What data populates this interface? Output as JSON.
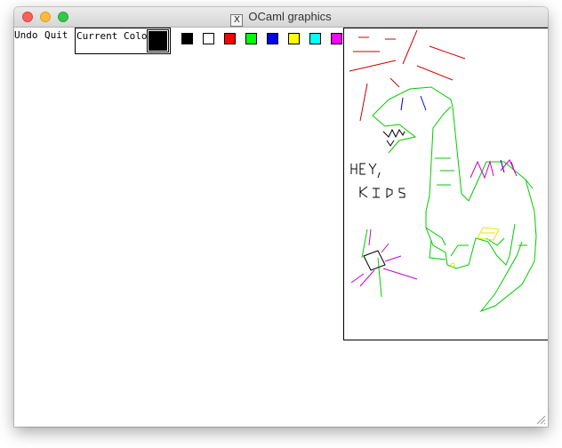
{
  "window": {
    "title": "OCaml graphics",
    "title_icon": "x11-icon"
  },
  "toolbar": {
    "undo_label": "Undo",
    "quit_label": "Quit",
    "current_color_label": "Current Color",
    "current_color": "#000000",
    "palette": [
      "#000000",
      "#ffffff",
      "#ff0000",
      "#00ff00",
      "#0000ff",
      "#ffff00",
      "#00ffff",
      "#ff00ff"
    ]
  },
  "drawing": {
    "text_hey": "HEY,",
    "text_kids": "KIDS",
    "colors": {
      "red": "#cc0000",
      "green": "#00cc00",
      "magenta": "#cc00cc",
      "blue": "#0000cc",
      "yellow": "#e6e600",
      "black": "#000000"
    }
  }
}
